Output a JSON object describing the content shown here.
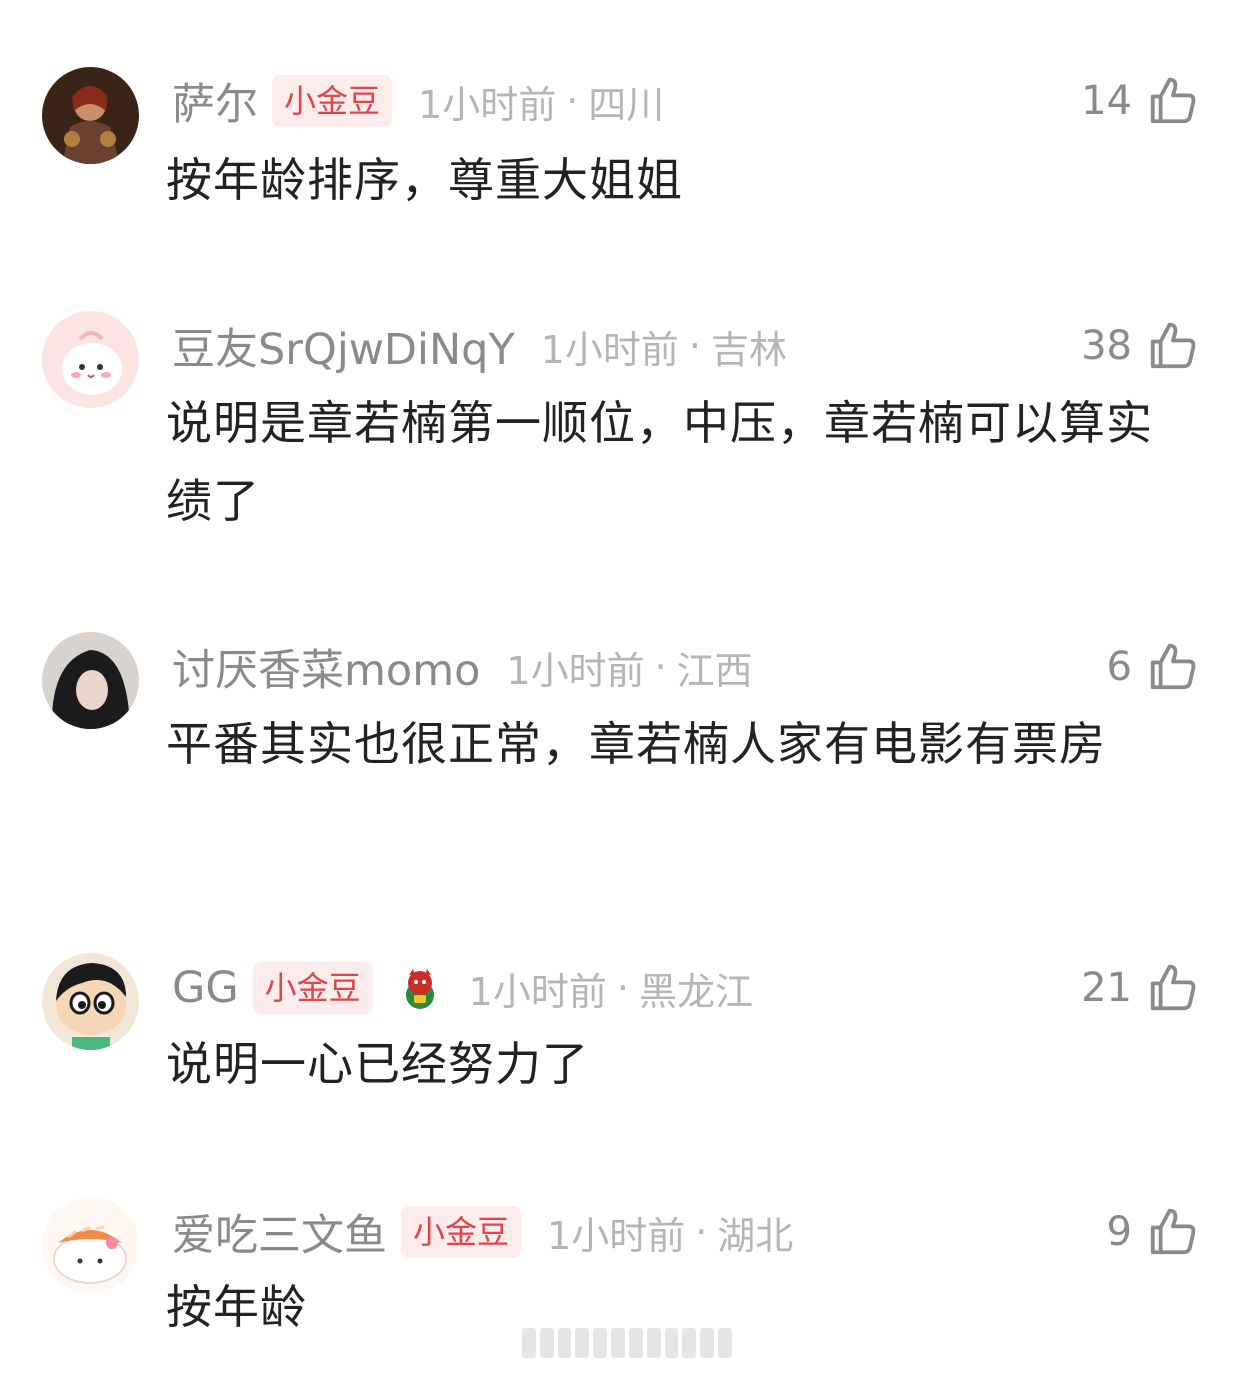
{
  "comments": [
    {
      "username": "萨尔",
      "badge": "小金豆",
      "time": "1小时前",
      "region": "四川",
      "likes": "14",
      "text": "按年龄排序，尊重大姐姐"
    },
    {
      "username": "豆友SrQjwDiNqY",
      "badge": "",
      "time": "1小时前",
      "region": "吉林",
      "likes": "38",
      "text": "说明是章若楠第一顺位，中压，章若楠可以算实绩了"
    },
    {
      "username": "讨厌香菜momo",
      "badge": "",
      "time": "1小时前",
      "region": "江西",
      "likes": "6",
      "text": "平番其实也很正常，章若楠人家有电影有票房"
    },
    {
      "username": "GG",
      "badge": "小金豆",
      "time": "1小时前",
      "region": "黑龙江",
      "likes": "21",
      "text": "说明一心已经努力了"
    },
    {
      "username": "爱吃三文鱼",
      "badge": "小金豆",
      "time": "1小时前",
      "region": "湖北",
      "likes": "9",
      "text": "按年龄"
    }
  ],
  "separator": "·",
  "icons": {
    "like": "thumbs-up-outline-icon",
    "extra_badge": "lucky-cat-emoji-icon"
  },
  "colors": {
    "username": "#8a8a8a",
    "meta": "#b5b5b5",
    "badge_text": "#e0454b",
    "badge_bg": "#fdecec",
    "body_text": "#222222"
  }
}
